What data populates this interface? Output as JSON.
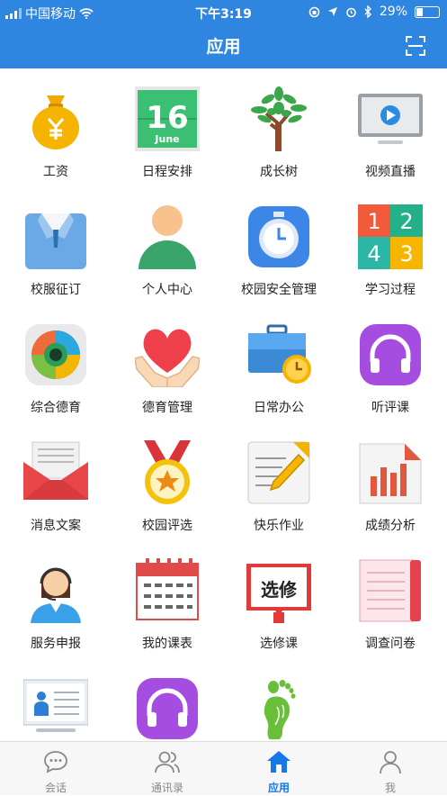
{
  "status_bar": {
    "carrier": "中国移动",
    "time": "下午3:19",
    "battery": "29%",
    "battery_level": 0.29
  },
  "header": {
    "title": "应用"
  },
  "apps": [
    {
      "label": "工资",
      "icon": "money-bag-icon"
    },
    {
      "label": "日程安排",
      "icon": "calendar-16-june-icon",
      "day": "16",
      "month": "June"
    },
    {
      "label": "成长树",
      "icon": "tree-icon"
    },
    {
      "label": "视频直播",
      "icon": "video-play-icon"
    },
    {
      "label": "校服征订",
      "icon": "uniform-shirt-icon"
    },
    {
      "label": "个人中心",
      "icon": "person-icon"
    },
    {
      "label": "校园安全管理",
      "icon": "clock-safety-icon"
    },
    {
      "label": "学习过程",
      "icon": "number-blocks-icon",
      "digits": [
        "1",
        "2",
        "4",
        "3"
      ]
    },
    {
      "label": "综合德育",
      "icon": "circle-menu-icon"
    },
    {
      "label": "德育管理",
      "icon": "heart-hands-icon"
    },
    {
      "label": "日常办公",
      "icon": "briefcase-icon"
    },
    {
      "label": "听评课",
      "icon": "headphones-icon"
    },
    {
      "label": "消息文案",
      "icon": "envelope-icon"
    },
    {
      "label": "校园评选",
      "icon": "medal-icon"
    },
    {
      "label": "快乐作业",
      "icon": "pen-paper-icon"
    },
    {
      "label": "成绩分析",
      "icon": "bar-report-icon"
    },
    {
      "label": "服务申报",
      "icon": "service-agent-icon"
    },
    {
      "label": "我的课表",
      "icon": "timetable-icon"
    },
    {
      "label": "选修课",
      "icon": "elective-book-icon",
      "text": "选修"
    },
    {
      "label": "调查问卷",
      "icon": "notebook-icon"
    },
    {
      "label": "",
      "icon": "presentation-board-icon"
    },
    {
      "label": "",
      "icon": "headphones-icon"
    },
    {
      "label": "",
      "icon": "footprint-icon"
    }
  ],
  "tabs": [
    {
      "label": "会话",
      "icon": "chat-icon",
      "active": false
    },
    {
      "label": "通讯录",
      "icon": "contacts-icon",
      "active": false
    },
    {
      "label": "应用",
      "icon": "home-icon",
      "active": true
    },
    {
      "label": "我",
      "icon": "user-icon",
      "active": false
    }
  ],
  "colors": {
    "primary": "#2f86e0",
    "tab_active": "#1677e6"
  }
}
